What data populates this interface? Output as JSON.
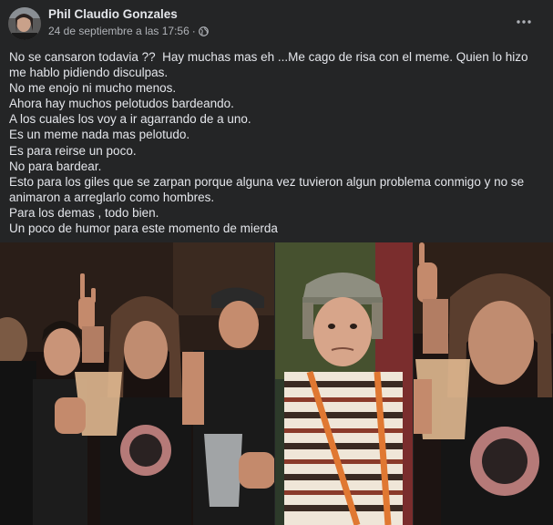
{
  "post": {
    "author": "Phil Claudio Gonzales",
    "timestamp": "24 de septiembre a las 17:56",
    "separator": "·",
    "privacy_icon": "globe-icon",
    "more_icon": "more-options-icon",
    "lines": [
      "No se cansaron todavia ??  Hay muchas mas eh ...Me cago de risa con el meme. Quien lo hizo me hablo pidiendo disculpas.",
      "No me enojo ni mucho menos.",
      "Ahora hay muchos pelotudos bardeando.",
      "A los cuales los voy a ir agarrando de a uno.",
      "Es un meme nada mas pelotudo.",
      "Es para reirse un poco.",
      "No para bardear.",
      "Esto para los giles que se zarpan porque alguna vez tuvieron algun problema conmigo y no se animaron a arreglarlo como hombres.",
      "Para los demas , todo bien.",
      "Un poco de humor para este momento de mierda"
    ]
  },
  "colors": {
    "background": "#242526",
    "primary_text": "#e4e6eb",
    "secondary_text": "#b0b3b8"
  }
}
